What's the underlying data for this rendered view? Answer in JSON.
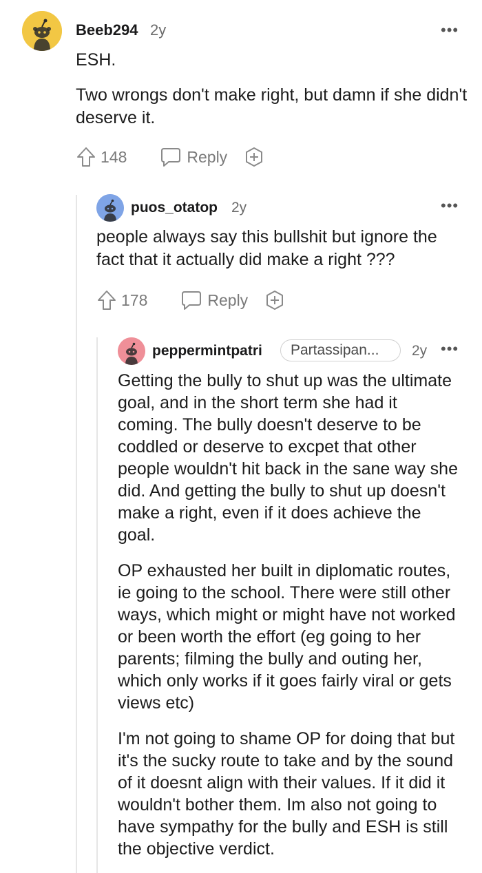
{
  "comments": [
    {
      "username": "Beeb294",
      "age": "2y",
      "more": "•••",
      "paragraphs": [
        "ESH.",
        "Two wrongs don't make right, but damn if she didn't deserve it."
      ],
      "upvotes": "148",
      "reply_label": "Reply",
      "avatar_color": "#f2c744"
    },
    {
      "username": "puos_otatop",
      "age": "2y",
      "more": "•••",
      "paragraphs": [
        "people always say this bullshit but ignore the fact that it actually did make a right ???"
      ],
      "upvotes": "178",
      "reply_label": "Reply",
      "avatar_color": "#7fa4e6"
    },
    {
      "username": "peppermintpatri",
      "flair": "Partassipan...",
      "age": "2y",
      "more": "•••",
      "paragraphs": [
        "Getting the bully to shut up was the ultimate goal, and in the short term she had it coming. The bully doesn't deserve to be coddled or deserve to excpet that other people wouldn't hit back in the sane way she did. And getting the bully to shut up doesn't make a right, even if it does achieve the goal.",
        "OP exhausted her built in diplomatic routes, ie going to the school. There were still other ways, which might or might have not worked or been worth the effort (eg going to her parents; filming the bully and outing her, which only works if it goes fairly viral or gets views etc)",
        "I'm not going to shame OP for doing that but it's the sucky route to take and by the sound of it doesnt align with their values. If it did it wouldn't bother them. Im also not going to have sympathy for the bully and ESH is still the objective verdict."
      ],
      "avatar_color": "#ef8f98"
    }
  ],
  "icons": {
    "upvote": "upvote-arrow-icon",
    "reply": "speech-bubble-icon",
    "award": "plus-circle-icon",
    "snoo": "snoo-avatar-icon"
  }
}
